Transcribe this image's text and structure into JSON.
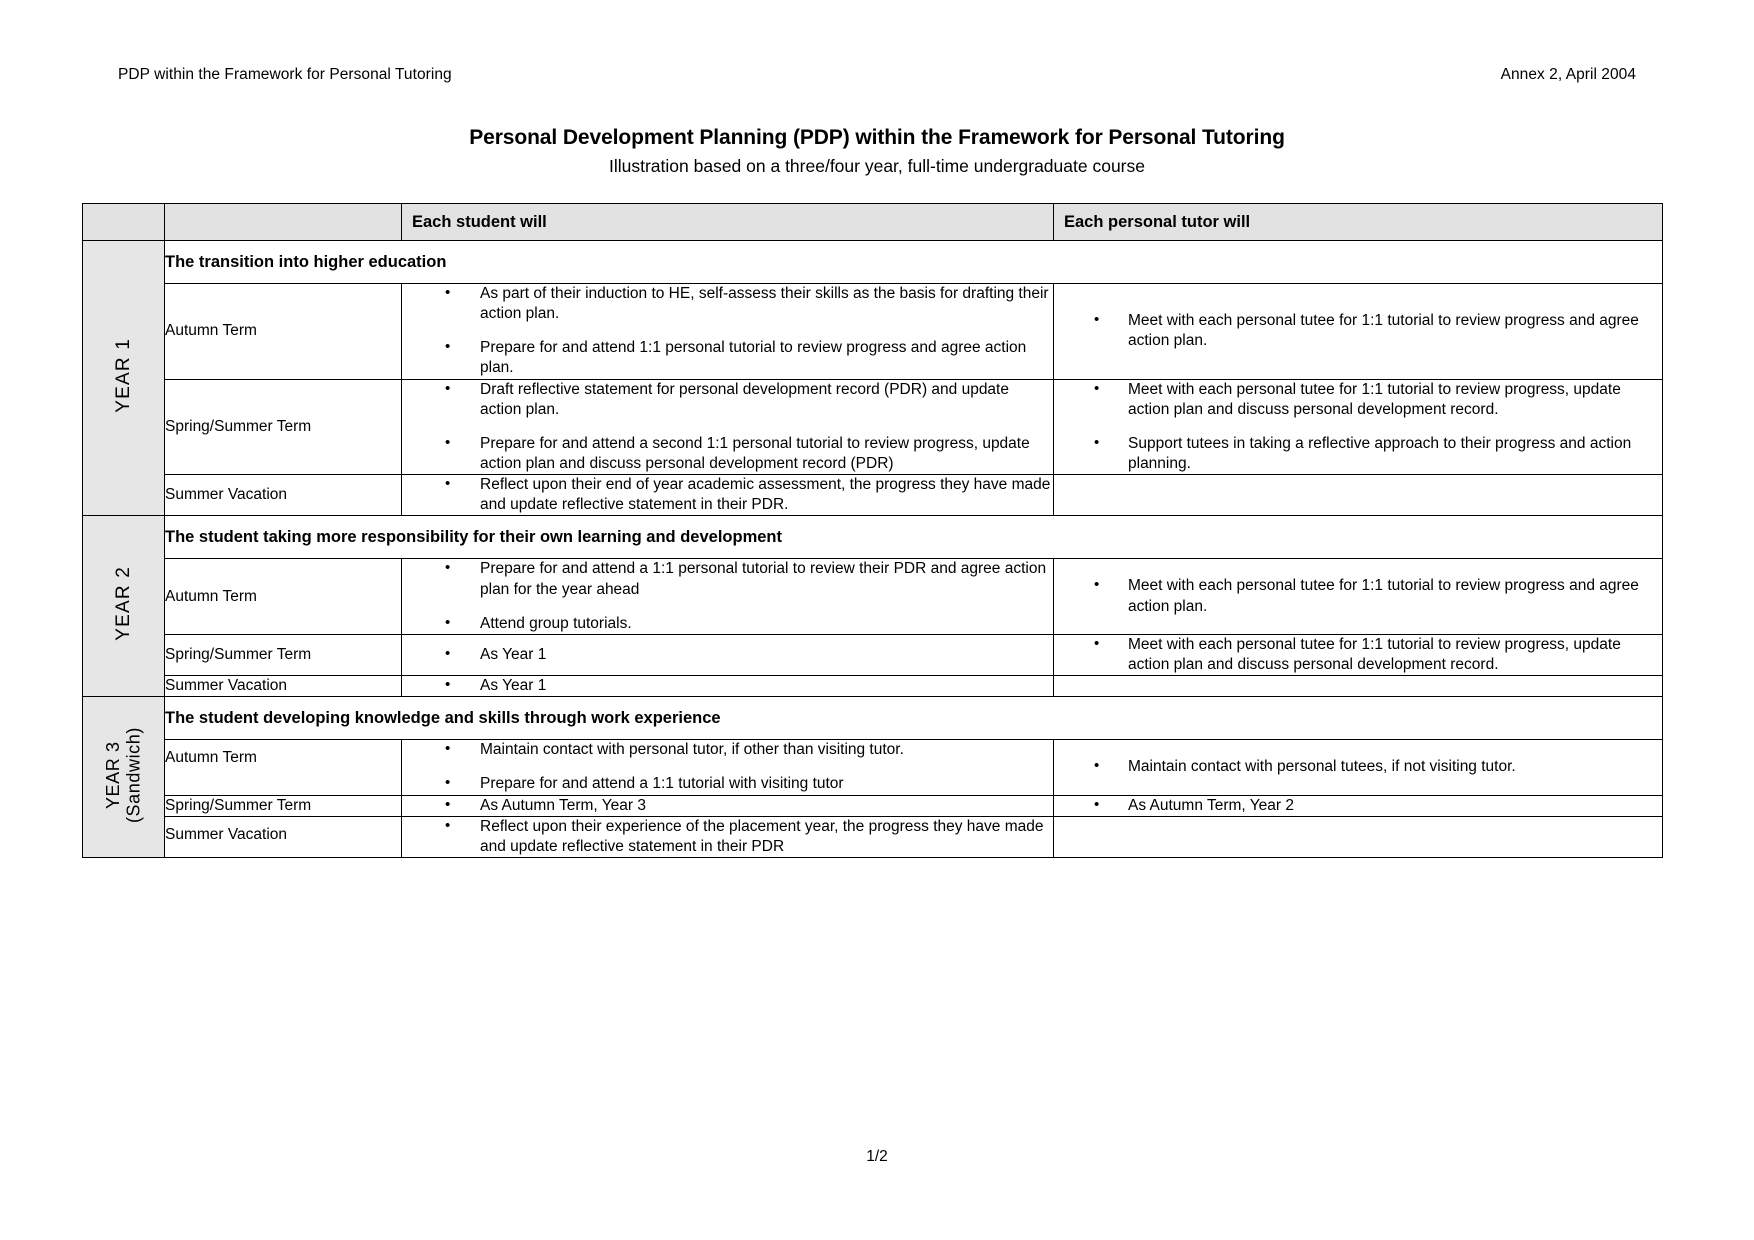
{
  "header": {
    "left": "PDP within the Framework for Personal Tutoring",
    "right": "Annex 2, April 2004"
  },
  "title": "Personal Development Planning (PDP) within the Framework for Personal Tutoring",
  "subtitle": "Illustration based on a three/four year, full-time undergraduate course",
  "table": {
    "columns": {
      "year": "",
      "term": "",
      "student": "Each student will",
      "tutor": "Each personal tutor will"
    },
    "years": [
      {
        "year_label": "YEAR 1",
        "year_sub": "",
        "section_heading": "The transition into higher education",
        "rows": [
          {
            "term": "Autumn Term",
            "student": [
              "As part of their induction to HE, self-assess their skills as the basis for drafting their action plan.",
              "Prepare for and attend 1:1 personal tutorial to review progress and agree action plan."
            ],
            "tutor": [
              "Meet with each personal tutee for 1:1 tutorial to review progress and agree action plan."
            ]
          },
          {
            "term": "Spring/Summer Term",
            "student": [
              "Draft reflective statement for personal development record (PDR) and update action plan.",
              "Prepare for and attend a second 1:1 personal tutorial to review progress, update action plan and discuss personal development record (PDR)"
            ],
            "tutor": [
              "Meet with each personal tutee for 1:1 tutorial to review progress, update action plan and discuss personal development record.",
              "Support tutees in taking a reflective approach to their progress and action planning."
            ]
          },
          {
            "term": "Summer Vacation",
            "student": [
              "Reflect upon their end of year academic assessment, the progress they have made and update reflective statement in their PDR."
            ],
            "tutor": []
          }
        ]
      },
      {
        "year_label": "YEAR 2",
        "year_sub": "",
        "section_heading": "The student taking more responsibility for their own  learning and development",
        "rows": [
          {
            "term": "Autumn Term",
            "student": [
              "Prepare for and attend a 1:1 personal tutorial to review their PDR and agree action plan for the year ahead",
              "Attend group tutorials."
            ],
            "tutor": [
              "Meet with each personal tutee for 1:1 tutorial to review progress and agree action plan."
            ]
          },
          {
            "term": "Spring/Summer Term",
            "student": [
              "As Year 1"
            ],
            "tutor": [
              "Meet with each personal tutee for 1:1 tutorial to review progress, update action plan and discuss personal development record."
            ]
          },
          {
            "term": "Summer Vacation",
            "student": [
              "As Year 1"
            ],
            "tutor": []
          }
        ]
      },
      {
        "year_label": "YEAR 3",
        "year_sub": "(Sandwich)",
        "section_heading": "The student developing knowledge and skills through work experience",
        "rows": [
          {
            "term": "Autumn Term",
            "student": [
              "Maintain contact with personal tutor, if other than visiting tutor.",
              "Prepare for and attend a 1:1 tutorial with visiting tutor"
            ],
            "tutor": [
              "Maintain contact with personal tutees, if not visiting tutor."
            ]
          },
          {
            "term": "Spring/Summer Term",
            "student": [
              "As Autumn Term, Year 3"
            ],
            "tutor": [
              "As Autumn Term, Year 2"
            ]
          },
          {
            "term": "Summer Vacation",
            "student": [
              "Reflect upon their experience of the placement year, the progress they have made and update reflective statement in their PDR"
            ],
            "tutor": []
          }
        ]
      }
    ]
  },
  "footer": {
    "page_number": "1/2"
  }
}
